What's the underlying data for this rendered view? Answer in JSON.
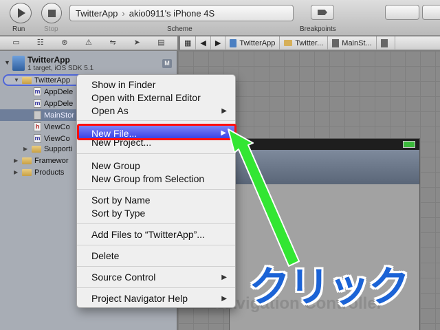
{
  "toolbar": {
    "run_label": "Run",
    "stop_label": "Stop",
    "scheme_target": "TwitterApp",
    "scheme_device": "akio0911's iPhone 4S",
    "scheme_label": "Scheme",
    "breakpoints_label": "Breakpoints"
  },
  "jumpbar": {
    "items": [
      "TwitterApp",
      "Twitter...",
      "MainSt...",
      ""
    ]
  },
  "navigator": {
    "project_name": "TwitterApp",
    "project_sub": "1 target, iOS SDK 5.1",
    "project_badge": "M",
    "group_name": "TwitterApp",
    "files": [
      {
        "icon": "m",
        "name": "AppDele"
      },
      {
        "icon": "m",
        "name": "AppDele"
      },
      {
        "icon": "sb",
        "name": "MainStor"
      },
      {
        "icon": "h",
        "name": "ViewCo"
      },
      {
        "icon": "m",
        "name": "ViewCo"
      }
    ],
    "folders": [
      "Supporti",
      "Framewor",
      "Products"
    ]
  },
  "menu": {
    "items": [
      {
        "label": "Show in Finder"
      },
      {
        "label": "Open with External Editor"
      },
      {
        "label": "Open As",
        "submenu": "▶"
      },
      {
        "label": "New File...",
        "submenu": "▶"
      },
      {
        "label": "New Project..."
      },
      {
        "label": "New Group"
      },
      {
        "label": "New Group from Selection"
      },
      {
        "label": "Sort by Name"
      },
      {
        "label": "Sort by Type"
      },
      {
        "label": "Add Files to “TwitterApp”..."
      },
      {
        "label": "Delete"
      },
      {
        "label": "Source Control",
        "submenu": "▶"
      },
      {
        "label": "Project Navigator Help",
        "submenu": "▶"
      }
    ]
  },
  "canvas": {
    "nav_controller_label": "Navigation Controller"
  },
  "annotation": {
    "callout": "クリック",
    "arrow_color": "#33e633",
    "highlight_color": "#ff1010",
    "callout_color": "#1b63d6"
  }
}
